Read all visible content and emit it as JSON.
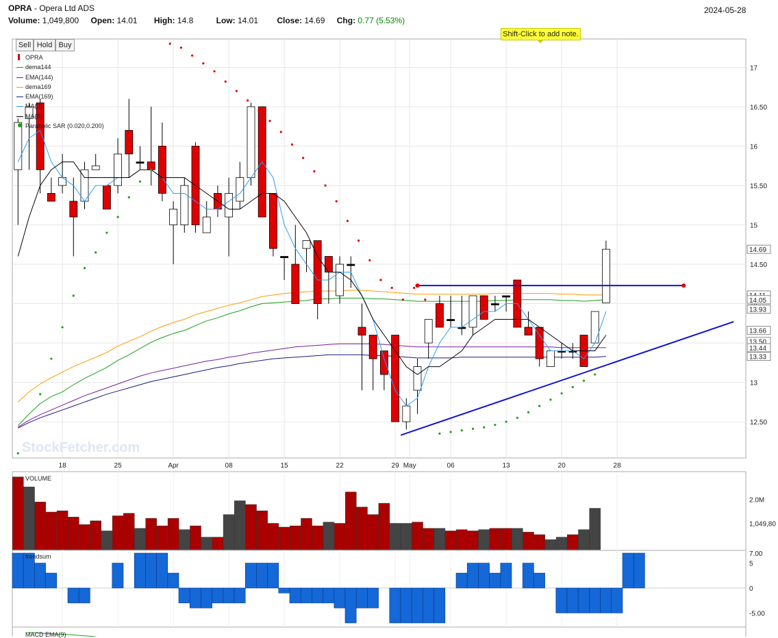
{
  "header": {
    "symbol": "OPRA",
    "company": " - Opera Ltd ADS",
    "date": "2024-05-28",
    "volume_label": "Volume:",
    "volume": "1,049,800",
    "open_label": "Open:",
    "open": "14.01",
    "high_label": "High:",
    "high": "14.8",
    "low_label": "Low:",
    "low": "14.01",
    "close_label": "Close:",
    "close": "14.69",
    "chg_label": "Chg:",
    "chg": "0.77 (5.53%)"
  },
  "toolbar": {
    "sell": "Sell",
    "hold": "Hold",
    "buy": "Buy"
  },
  "tooltip": "Shift-Click to add note.",
  "watermark": "StockFetcher.com",
  "colors": {
    "up": "#ffffff",
    "down": "#e00000",
    "doji": "#000000",
    "dema144": "#1aa01a",
    "ema144": "#7a1aa0",
    "dema169": "#ff9900",
    "ema169": "#1a1a80",
    "ma3": "#2a9df4",
    "ma8": "#000000",
    "sar": "#1aa01a",
    "sar_above": "#e00000",
    "trendline": "#1010d0",
    "volume_down": "#aa0000",
    "volume_up": "#444444",
    "trendsum": "#1468d8",
    "chg": "#008800"
  },
  "legend": [
    {
      "label": "OPRA",
      "type": "bar",
      "color": "#d40000"
    },
    {
      "label": "dema144",
      "type": "line",
      "color": "#1aa01a"
    },
    {
      "label": "EMA(144)",
      "type": "line",
      "color": "#7a1aa0"
    },
    {
      "label": "dema169",
      "type": "line",
      "color": "#ff9900"
    },
    {
      "label": "EMA(169)",
      "type": "line",
      "color": "#1a1a80"
    },
    {
      "label": "MA(3)",
      "type": "line",
      "color": "#2a9df4"
    },
    {
      "label": "MA(8)",
      "type": "line",
      "color": "#000000"
    },
    {
      "label": "Parabolic SAR (0.020,0.200)",
      "type": "dot",
      "color": "#1aa01a"
    }
  ],
  "panel_labels": {
    "volume": "VOLUME",
    "trendsum": "trendsum",
    "macd": "MACD EMA(9)"
  },
  "chart_data": {
    "type": "candlestick",
    "x_tick_labels": [
      "18",
      "25",
      "Apr",
      "08",
      "15",
      "22",
      "29",
      "May",
      "06",
      "13",
      "20",
      "28"
    ],
    "x_tick_index": [
      4,
      9,
      14,
      19,
      24,
      29,
      34,
      35.3,
      39,
      44,
      49,
      54
    ],
    "y_ticks": [
      12.5,
      13,
      13.5,
      14,
      14.5,
      15,
      15.5,
      16,
      16.5,
      17
    ],
    "y_tick_labels": [
      "12.50",
      "13",
      "13.50",
      "14",
      "14.50",
      "15",
      "15.50",
      "16",
      "16.50",
      "17"
    ],
    "ylim": [
      12.04,
      17.36
    ],
    "price_tags": [
      {
        "label": "14.69",
        "value": 14.69
      },
      {
        "label": "14.11",
        "value": 14.11
      },
      {
        "label": "14.05",
        "value": 14.05
      },
      {
        "label": "13.93",
        "value": 13.93
      },
      {
        "label": "13.66",
        "value": 13.66
      },
      {
        "label": "13.50",
        "value": 13.52
      },
      {
        "label": "13.44",
        "value": 13.44
      },
      {
        "label": "13.33",
        "value": 13.33
      }
    ],
    "candles": [
      [
        15.7,
        16.3,
        15.0,
        16.35
      ],
      [
        16.35,
        16.5,
        15.7,
        16.55
      ],
      [
        16.55,
        15.7,
        15.4,
        16.6
      ],
      [
        15.4,
        15.3,
        15.3,
        15.6
      ],
      [
        15.5,
        15.6,
        15.4,
        15.9
      ],
      [
        15.3,
        15.1,
        14.6,
        15.6
      ],
      [
        15.3,
        15.7,
        15.2,
        15.8
      ],
      [
        15.7,
        15.75,
        15.7,
        15.9
      ],
      [
        15.5,
        15.2,
        15.2,
        15.5
      ],
      [
        15.5,
        15.9,
        15.4,
        16.1
      ],
      [
        16.2,
        15.9,
        15.6,
        16.6
      ],
      [
        15.8,
        15.8,
        15.7,
        16.0
      ],
      [
        15.8,
        15.7,
        15.5,
        16.5
      ],
      [
        16.0,
        15.4,
        15.3,
        16.3
      ],
      [
        15.0,
        15.2,
        14.5,
        15.3
      ],
      [
        15.0,
        15.5,
        14.9,
        15.6
      ],
      [
        16.0,
        15.0,
        14.9,
        16.05
      ],
      [
        14.9,
        15.1,
        14.9,
        15.3
      ],
      [
        15.4,
        15.2,
        15.1,
        15.5
      ],
      [
        15.1,
        15.4,
        14.6,
        15.6
      ],
      [
        15.3,
        15.6,
        15.2,
        15.8
      ],
      [
        15.6,
        16.5,
        15.5,
        16.55
      ],
      [
        16.5,
        15.1,
        15.1,
        16.5
      ],
      [
        15.4,
        14.7,
        14.6,
        15.4
      ],
      [
        14.6,
        14.6,
        14.3,
        14.6
      ],
      [
        14.5,
        14.0,
        14.2,
        15.0
      ],
      [
        14.7,
        14.8,
        14.4,
        14.8
      ],
      [
        14.8,
        14.0,
        13.8,
        14.8
      ],
      [
        14.6,
        14.4,
        14.0,
        14.6
      ],
      [
        14.1,
        14.5,
        14.0,
        14.6
      ],
      [
        14.5,
        14.5,
        14.2,
        14.6
      ],
      [
        13.7,
        13.6,
        12.9,
        14.0
      ],
      [
        13.6,
        13.3,
        12.9,
        13.6
      ],
      [
        13.4,
        13.1,
        12.9,
        13.4
      ],
      [
        13.6,
        12.5,
        12.5,
        13.6
      ],
      [
        12.5,
        12.7,
        12.4,
        12.8
      ],
      [
        12.9,
        13.2,
        12.6,
        13.3
      ],
      [
        13.5,
        13.8,
        13.3,
        13.8
      ],
      [
        14.0,
        13.7,
        13.7,
        14.1
      ],
      [
        13.8,
        13.8,
        13.7,
        14.1
      ],
      [
        13.7,
        13.7,
        13.6,
        14.1
      ],
      [
        13.7,
        14.1,
        13.6,
        14.1
      ],
      [
        14.1,
        13.8,
        13.8,
        14.1
      ],
      [
        14.0,
        14.0,
        13.9,
        14.1
      ],
      [
        14.1,
        14.1,
        13.9,
        14.1
      ],
      [
        14.3,
        13.7,
        13.7,
        14.3
      ],
      [
        13.7,
        13.6,
        13.6,
        13.9
      ],
      [
        13.7,
        13.3,
        13.2,
        13.7
      ],
      [
        13.2,
        13.4,
        13.2,
        13.4
      ],
      [
        13.4,
        13.4,
        13.3,
        13.5
      ],
      [
        13.4,
        13.4,
        13.3,
        13.5
      ],
      [
        13.6,
        13.2,
        13.2,
        13.6
      ],
      [
        13.5,
        13.9,
        13.5,
        13.9
      ],
      [
        14.01,
        14.69,
        14.01,
        14.8
      ]
    ],
    "ma3": [
      15.8,
      16.1,
      16.2,
      15.8,
      15.6,
      15.5,
      15.3,
      15.5,
      15.5,
      15.6,
      15.6,
      15.7,
      15.7,
      15.6,
      15.4,
      15.4,
      15.3,
      15.2,
      15.2,
      15.3,
      15.4,
      15.6,
      15.8,
      15.6,
      15.0,
      14.7,
      14.5,
      14.3,
      14.3,
      14.4,
      14.4,
      14.1,
      13.8,
      13.3,
      12.9,
      12.7,
      12.8,
      13.2,
      13.5,
      13.7,
      13.7,
      13.8,
      13.9,
      13.9,
      14.0,
      14.0,
      13.8,
      13.6,
      13.4,
      13.4,
      13.4,
      13.3,
      13.5,
      13.9
    ],
    "ma8": [
      14.6,
      15.1,
      15.5,
      15.7,
      15.8,
      15.8,
      15.6,
      15.6,
      15.6,
      15.6,
      15.6,
      15.7,
      15.7,
      15.6,
      15.6,
      15.6,
      15.5,
      15.4,
      15.3,
      15.2,
      15.2,
      15.3,
      15.4,
      15.4,
      15.3,
      15.1,
      14.9,
      14.6,
      14.4,
      14.4,
      14.3,
      14.1,
      13.8,
      13.6,
      13.4,
      13.2,
      13.1,
      13.2,
      13.2,
      13.3,
      13.4,
      13.6,
      13.7,
      13.8,
      13.8,
      13.8,
      13.8,
      13.7,
      13.6,
      13.5,
      13.4,
      13.4,
      13.4,
      13.6
    ],
    "dema144": [
      12.45,
      12.6,
      12.73,
      12.82,
      12.88,
      12.97,
      13.05,
      13.12,
      13.19,
      13.28,
      13.35,
      13.43,
      13.51,
      13.57,
      13.62,
      13.66,
      13.72,
      13.78,
      13.82,
      13.87,
      13.91,
      13.96,
      14.0,
      14.01,
      14.02,
      14.03,
      14.04,
      14.06,
      14.06,
      14.07,
      14.07,
      14.07,
      14.06,
      14.06,
      14.05,
      14.04,
      14.03,
      14.03,
      14.03,
      14.03,
      14.03,
      14.03,
      14.03,
      14.04,
      14.04,
      14.05,
      14.05,
      14.05,
      14.05,
      14.04,
      14.04,
      14.03,
      14.04,
      14.05
    ],
    "dema169": [
      12.75,
      12.88,
      12.98,
      13.06,
      13.13,
      13.2,
      13.26,
      13.32,
      13.38,
      13.46,
      13.52,
      13.58,
      13.65,
      13.71,
      13.76,
      13.8,
      13.86,
      13.9,
      13.94,
      13.98,
      14.01,
      14.05,
      14.09,
      14.11,
      14.13,
      14.14,
      14.15,
      14.16,
      14.16,
      14.16,
      14.17,
      14.17,
      14.16,
      14.15,
      14.14,
      14.13,
      14.12,
      14.12,
      14.12,
      14.12,
      14.12,
      14.12,
      14.12,
      14.13,
      14.13,
      14.13,
      14.13,
      14.13,
      14.13,
      14.12,
      14.12,
      14.11,
      14.11,
      14.11
    ],
    "ema144": [
      12.43,
      12.52,
      12.59,
      12.65,
      12.71,
      12.77,
      12.83,
      12.88,
      12.93,
      12.98,
      13.03,
      13.08,
      13.12,
      13.15,
      13.18,
      13.21,
      13.24,
      13.27,
      13.29,
      13.32,
      13.34,
      13.37,
      13.39,
      13.41,
      13.43,
      13.45,
      13.46,
      13.47,
      13.48,
      13.49,
      13.49,
      13.49,
      13.49,
      13.48,
      13.47,
      13.46,
      13.45,
      13.45,
      13.45,
      13.45,
      13.45,
      13.45,
      13.45,
      13.45,
      13.45,
      13.45,
      13.45,
      13.45,
      13.45,
      13.44,
      13.44,
      13.44,
      13.44,
      13.44
    ],
    "ema169": [
      12.42,
      12.49,
      12.55,
      12.6,
      12.65,
      12.7,
      12.75,
      12.8,
      12.85,
      12.89,
      12.93,
      12.97,
      13.01,
      13.04,
      13.07,
      13.1,
      13.13,
      13.16,
      13.19,
      13.21,
      13.24,
      13.26,
      13.28,
      13.3,
      13.31,
      13.32,
      13.33,
      13.34,
      13.35,
      13.35,
      13.35,
      13.35,
      13.34,
      13.34,
      13.33,
      13.32,
      13.31,
      13.31,
      13.31,
      13.31,
      13.32,
      13.32,
      13.32,
      13.32,
      13.32,
      13.32,
      13.32,
      13.32,
      13.32,
      13.32,
      13.32,
      13.32,
      13.32,
      13.33
    ],
    "sar": [
      12.1,
      12.85,
      13.3,
      13.7,
      14.1,
      14.45,
      14.65,
      14.9,
      15.1,
      15.35,
      15.55,
      15.7,
      15.75,
      17.3,
      17.25,
      17.15,
      17.05,
      16.95,
      16.82,
      16.7,
      16.58,
      16.45,
      16.32,
      16.18,
      16.02,
      15.85,
      15.68,
      15.5,
      15.3,
      15.05,
      14.8,
      14.55,
      14.3,
      14.2,
      14.05,
      14.2,
      14.05,
      12.35,
      12.37,
      12.39,
      12.41,
      12.43,
      12.46,
      12.5,
      12.55,
      12.62,
      12.7,
      12.78,
      12.86,
      12.94,
      13.02,
      13.1
    ],
    "sar_index": [
      0,
      2,
      3,
      4,
      5,
      6,
      7,
      8,
      9,
      10,
      11,
      12,
      13,
      13.7,
      14.7,
      15.7,
      16.7,
      17.7,
      18.7,
      19.7,
      20.7,
      21.7,
      22.7,
      23.7,
      24.7,
      25.7,
      26.7,
      27.7,
      28.7,
      29.7,
      30.7,
      31.7,
      32.7,
      33.7,
      34.7,
      35.7,
      36.7,
      38,
      39,
      40,
      41,
      42,
      43,
      44,
      45,
      46,
      47,
      48,
      49,
      50,
      51,
      52
    ],
    "resistance_line": {
      "from": [
        36,
        14.23
      ],
      "to": [
        60,
        14.23
      ]
    },
    "support_line": {
      "from": [
        34.5,
        12.33
      ],
      "to": [
        64.5,
        13.77
      ]
    },
    "volume": {
      "values": [
        2.9,
        2.5,
        1.9,
        1.5,
        1.55,
        1.3,
        1.0,
        1.15,
        0.75,
        1.35,
        1.45,
        0.85,
        1.25,
        0.95,
        1.25,
        0.8,
        0.95,
        0.5,
        0.5,
        1.4,
        1.95,
        1.8,
        1.55,
        1.05,
        0.9,
        0.95,
        1.25,
        0.95,
        1.1,
        1.05,
        2.3,
        1.7,
        1.4,
        1.85,
        1.05,
        1.05,
        1.1,
        0.85,
        0.85,
        0.75,
        0.8,
        0.75,
        0.8,
        0.85,
        0.85,
        0.85,
        0.7,
        0.6,
        0.4,
        0.5,
        0.6,
        0.8,
        1.65
      ],
      "up": [
        0,
        1,
        0,
        0,
        0,
        0,
        0,
        0,
        1,
        0,
        0,
        1,
        0,
        0,
        0,
        1,
        0,
        1,
        0,
        1,
        1,
        0,
        0,
        0,
        0,
        0,
        0,
        0,
        1,
        0,
        0,
        0,
        0,
        0,
        1,
        1,
        0,
        0,
        1,
        0,
        0,
        0,
        1,
        0,
        0,
        1,
        0,
        0,
        1,
        1,
        0,
        1,
        1
      ],
      "ylim": [
        0,
        3.0
      ],
      "tick_labels": [
        "2.0M",
        "1,049,80"
      ],
      "tick_values": [
        2.0,
        1.05
      ]
    },
    "trendsum": {
      "values": [
        7,
        7,
        5,
        3,
        0,
        -3,
        -3,
        0,
        0,
        5,
        0,
        7,
        7,
        7,
        3,
        -3,
        -4,
        -4,
        -3,
        -3,
        -3,
        5,
        5,
        5,
        -1,
        -3,
        -3,
        -3,
        -3,
        -4,
        -7,
        -4,
        -4,
        0,
        -7,
        -7,
        -7,
        -7,
        -7,
        0,
        3,
        5,
        5,
        3,
        5,
        0,
        5,
        3,
        0,
        -5,
        -5,
        -5,
        -5,
        -5,
        -5,
        7,
        7
      ],
      "ylim": [
        -7,
        7
      ],
      "tick_labels": [
        "7.00",
        "5",
        "0",
        "-5.00"
      ],
      "tick_values": [
        7,
        5,
        0,
        -5
      ]
    }
  }
}
